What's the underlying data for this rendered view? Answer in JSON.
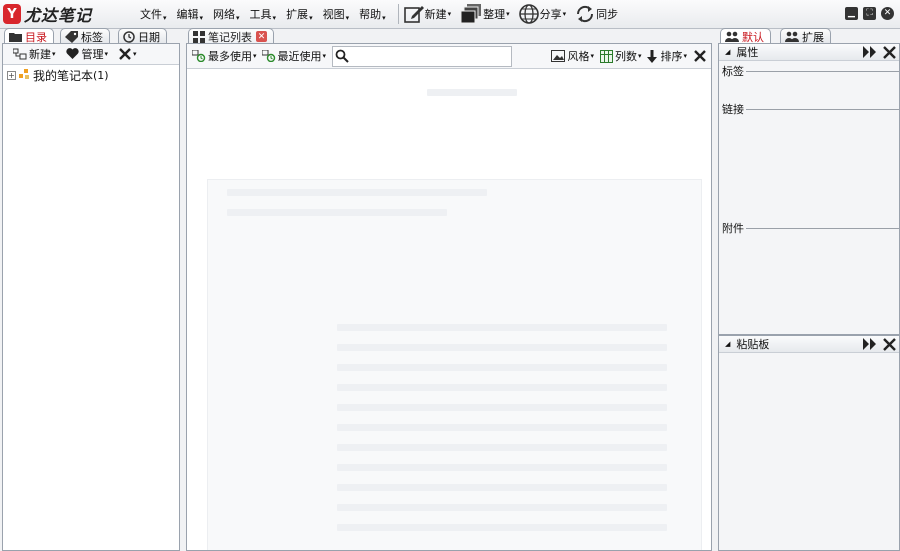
{
  "app": {
    "logo_text": "尤达笔记",
    "brand_color": "#d8262c"
  },
  "menu": {
    "items": [
      "文件",
      "编辑",
      "网络",
      "工具",
      "扩展",
      "视图",
      "帮助"
    ]
  },
  "toolbar": {
    "new_label": "新建",
    "organize_label": "整理",
    "share_label": "分享",
    "sync_label": "同步"
  },
  "left_tabs": {
    "catalog": "目录",
    "tags": "标签",
    "date": "日期"
  },
  "left_toolbar": {
    "new_label": "新建",
    "manage_label": "管理"
  },
  "tree": {
    "root_label": "我的笔记本",
    "root_count": "(1)"
  },
  "mid_tab": {
    "label": "笔记列表"
  },
  "mid_toolbar": {
    "most_used": "最多使用",
    "recent_used": "最近使用",
    "style": "风格",
    "columns": "列数",
    "sort": "排序"
  },
  "right_tabs": {
    "default": "默认",
    "extend": "扩展"
  },
  "properties_panel": {
    "title": "属性",
    "tags_label": "标签",
    "links_label": "链接",
    "attachments_label": "附件"
  },
  "clipboard_panel": {
    "title": "粘贴板"
  }
}
